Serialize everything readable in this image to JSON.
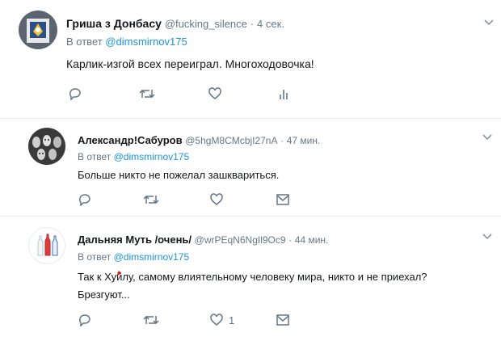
{
  "tweets": [
    {
      "name": "Гриша з Донбасу",
      "handle": "@fucking_silence",
      "time": "4 сек.",
      "reply_prefix": "В ответ",
      "reply_to": "@dimsmirnov175",
      "text": "Карлик-изгой всех переиграл. Многоходовочка!",
      "actions": [
        "reply-icon",
        "retweet-icon",
        "like-icon",
        "analytics-icon"
      ]
    },
    {
      "name": "Александр!Сабуров",
      "handle": "@5hgM8CMcbjI27nA",
      "time": "47 мин.",
      "reply_prefix": "В ответ",
      "reply_to": "@dimsmirnov175",
      "text": "Больше никто не пожелал зашквариться.",
      "actions": [
        "reply-icon",
        "retweet-icon",
        "like-icon",
        "message-icon"
      ]
    },
    {
      "name": "Дальняя Муть /очень/",
      "handle": "@wrPEqN6NgIl9Oc9",
      "time": "44 мин.",
      "reply_prefix": "В ответ",
      "reply_to": "@dimsmirnov175",
      "text": "Так к Хуйлу, самому влиятельному человеку мира, никто и не приехал? Брезгуют...",
      "like_count": "1",
      "actions": [
        "reply-icon",
        "retweet-icon",
        "like-icon",
        "message-icon"
      ]
    }
  ],
  "separator": "·",
  "colors": {
    "link": "#1b95e0",
    "muted": "#657786",
    "text": "#14171a",
    "divider": "#e6ecf0"
  }
}
